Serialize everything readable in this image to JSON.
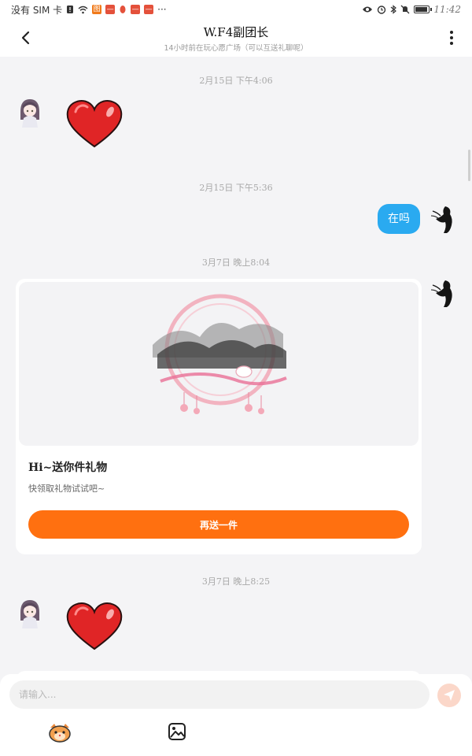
{
  "statusbar": {
    "left_text": "没有 SIM 卡",
    "time": "11:42",
    "icons": [
      "sim-alert-icon",
      "wifi-icon",
      "app-badge-icon",
      "app-badge-icon",
      "app-dot-icon",
      "app-badge-icon",
      "app-badge-icon",
      "more-dots-icon",
      "eye-icon",
      "alarm-icon",
      "bluetooth-icon",
      "mute-icon",
      "battery-icon"
    ],
    "more": "···"
  },
  "header": {
    "title": "W.F4副团长",
    "subtitle": "14小时前在玩心愿广场（可以互送礼聊呢）",
    "back_icon": "chevron-left-icon",
    "more_icon": "vertical-dots-icon"
  },
  "messages": [
    {
      "timestamp": "2月15日 下午4:06",
      "sender": "other",
      "type": "sticker",
      "sticker": "red-heart"
    },
    {
      "timestamp": "2月15日 下午5:36",
      "sender": "me",
      "type": "text",
      "text": "在吗"
    },
    {
      "timestamp": "3月7日 晚上8:04",
      "sender": "me",
      "type": "gift",
      "gift": {
        "title": "Hi~送你件礼物",
        "desc": "快领取礼物试试吧~",
        "button": "再送一件"
      }
    },
    {
      "timestamp": "3月7日 晚上8:25",
      "sender": "other",
      "type": "sticker",
      "sticker": "red-heart"
    }
  ],
  "input": {
    "placeholder": "请输入...",
    "send_icon": "send-icon",
    "tools": [
      "emoji-mascot-icon",
      "image-icon"
    ]
  },
  "colors": {
    "accent_blue": "#2aaaf0",
    "accent_orange": "#ff7010",
    "background": "#f4f4f6"
  }
}
